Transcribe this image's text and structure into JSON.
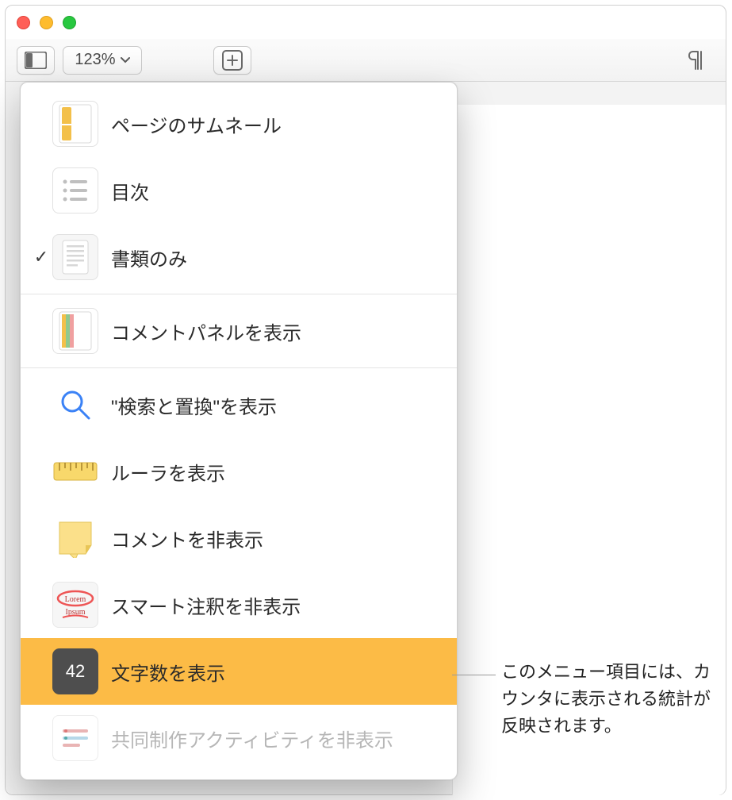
{
  "toolbar": {
    "zoom_value": "123%"
  },
  "menu": {
    "items": [
      {
        "label": "ページのサムネール",
        "checked": false
      },
      {
        "label": "目次",
        "checked": false
      },
      {
        "label": "書類のみ",
        "checked": true
      },
      {
        "label": "コメントパネルを表示",
        "checked": false
      },
      {
        "label": "\"検索と置換\"を表示",
        "checked": false
      },
      {
        "label": "ルーラを表示",
        "checked": false
      },
      {
        "label": "コメントを非表示",
        "checked": false
      },
      {
        "label": "スマート注釈を非表示",
        "checked": false
      },
      {
        "label": "文字数を表示",
        "checked": false,
        "selected": true,
        "badge": "42"
      },
      {
        "label": "共同制作アクティビティを非表示",
        "checked": false,
        "disabled": true
      }
    ]
  },
  "callout": "このメニュー項目には、カウンタに表示される統計が反映されます。"
}
